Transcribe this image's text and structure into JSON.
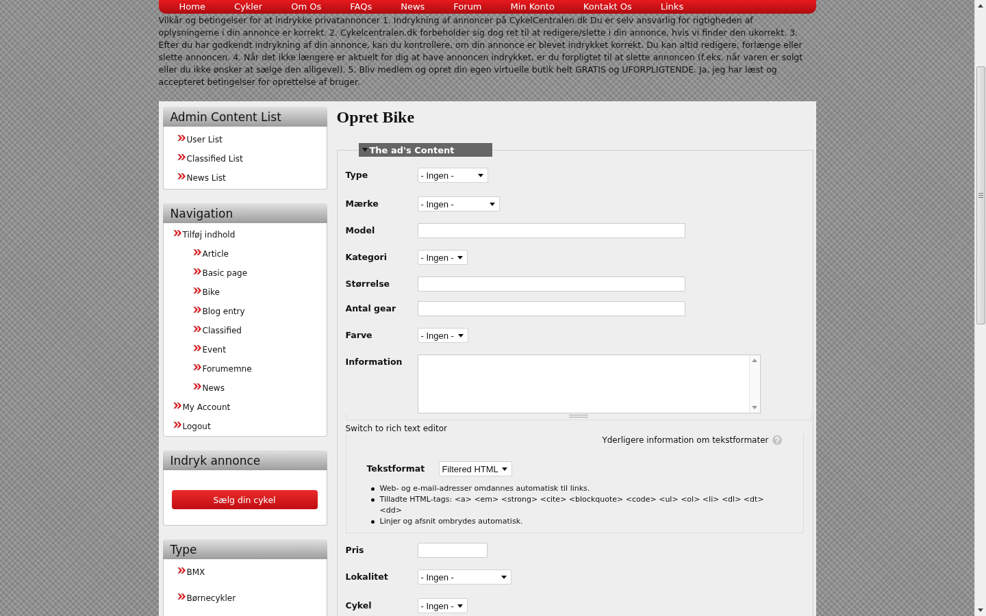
{
  "nav": {
    "items": [
      {
        "label": "Home"
      },
      {
        "label": "Cykler"
      },
      {
        "label": "Om Os"
      },
      {
        "label": "FAQs"
      },
      {
        "label": "News"
      },
      {
        "label": "Forum"
      },
      {
        "label": "Min Konto"
      },
      {
        "label": "Kontakt Os"
      },
      {
        "label": "Links"
      }
    ]
  },
  "terms": "Vilkår og betingelser for at indrykke privatannoncer 1. Indrykning af annoncer på CykelCentralen.dk Du er selv ansvarlig for rigtigheden af oplysningerne i din annonce er korrekt. 2. Cykelcentralen.dk forbeholder sig dog ret til at redigere/slette i din annonce, hvis vi finder den ukorrekt. 3. Efter du har godkendt indrykning af din annonce, kan du kontrollere, om din annonce er blevet indrykket korrekt. Du kan altid redigere, forlænge eller slette annoncen. 4. Når det ikke længere er aktuelt for dig at have annoncen indrykket, er du forpligtet til at slette annoncen (f.eks. når varen er solgt eller du ikke ønsker at sælge den alligevel). 5. Bliv medlem og opret din egen virtuelle butik helt GRATIS og UFORPLIGTENDE. Ja, jeg har læst og accepteret betingelser for oprettelse af bruger.",
  "sidebar": {
    "blocks": [
      {
        "kind": "links",
        "title": "Admin Content List",
        "items": [
          {
            "label": "User List"
          },
          {
            "label": "Classified List"
          },
          {
            "label": "News List"
          }
        ]
      },
      {
        "kind": "menu",
        "title": "Navigation",
        "items": [
          {
            "label": "Tilføj indhold",
            "children": [
              {
                "label": "Article"
              },
              {
                "label": "Basic page"
              },
              {
                "label": "Bike"
              },
              {
                "label": "Blog entry"
              },
              {
                "label": "Classified"
              },
              {
                "label": "Event"
              },
              {
                "label": "Forumemne"
              },
              {
                "label": "News"
              }
            ]
          },
          {
            "label": "My Account"
          },
          {
            "label": "Logout"
          }
        ]
      },
      {
        "kind": "cta",
        "title": "Indryk annonce",
        "button": "Sælg din cykel"
      },
      {
        "kind": "facets",
        "title": "Type",
        "items": [
          {
            "label": "BMX"
          },
          {
            "label": "Børnecykler"
          }
        ]
      }
    ]
  },
  "main": {
    "title": "Opret Bike",
    "fieldset": {
      "legend": "The ad's Content",
      "expanded": true,
      "fields": [
        {
          "kind": "select",
          "label": "Type",
          "value": "- Ingen -"
        },
        {
          "kind": "select",
          "label": "Mærke",
          "value": "- Ingen -"
        },
        {
          "kind": "text",
          "label": "Model"
        },
        {
          "kind": "select",
          "label": "Kategori",
          "value": "- Ingen -"
        },
        {
          "kind": "text",
          "label": "Størrelse"
        },
        {
          "kind": "text",
          "label": "Antal gear"
        },
        {
          "kind": "select",
          "label": "Farve",
          "value": "- Ingen -"
        },
        {
          "kind": "textarea",
          "label": "Information",
          "editor_toggle": "Switch to rich text editor",
          "format": {
            "help_link": "Yderligere information om tekstformater",
            "label": "Tekstformat",
            "value": "Filtered HTML",
            "tips": [
              "Web- og e-mail-adresser omdannes automatisk til links.",
              "Tilladte HTML-tags: <a> <em> <strong> <cite> <blockquote> <code> <ul> <ol> <li> <dl> <dt> <dd>",
              "Linjer og afsnit ombrydes automatisk."
            ]
          }
        },
        {
          "kind": "text",
          "label": "Pris"
        },
        {
          "kind": "select",
          "label": "Lokalitet",
          "value": "- Ingen -"
        },
        {
          "kind": "select",
          "label": "Cykel",
          "value": "- Ingen -"
        }
      ]
    }
  }
}
